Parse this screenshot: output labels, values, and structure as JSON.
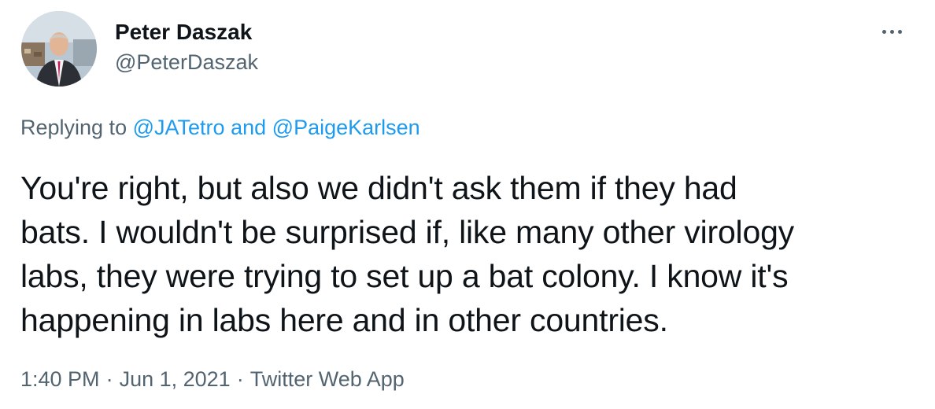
{
  "author": {
    "display_name": "Peter Daszak",
    "handle": "@PeterDaszak",
    "avatar_icon": "profile-photo"
  },
  "more_icon": "more-horizontal-icon",
  "reply": {
    "prefix": "Replying to",
    "mention_1": "@JATetro",
    "conjunction": "and",
    "mention_2": "@PaigeKarlsen"
  },
  "tweet": {
    "lines": [
      "You're right, but also we didn't ask them if they had",
      "bats. I wouldn't be surprised if, like many other virology",
      "labs, they were trying to set up a bat colony. I know it's",
      "happening in labs here and in other countries."
    ]
  },
  "meta": {
    "time": "1:40 PM",
    "separator": "·",
    "date": "Jun 1, 2021",
    "source": "Twitter Web App"
  },
  "colors": {
    "text": "#0f1419",
    "secondary": "#536471",
    "link": "#1d9bf0",
    "background": "#ffffff"
  }
}
